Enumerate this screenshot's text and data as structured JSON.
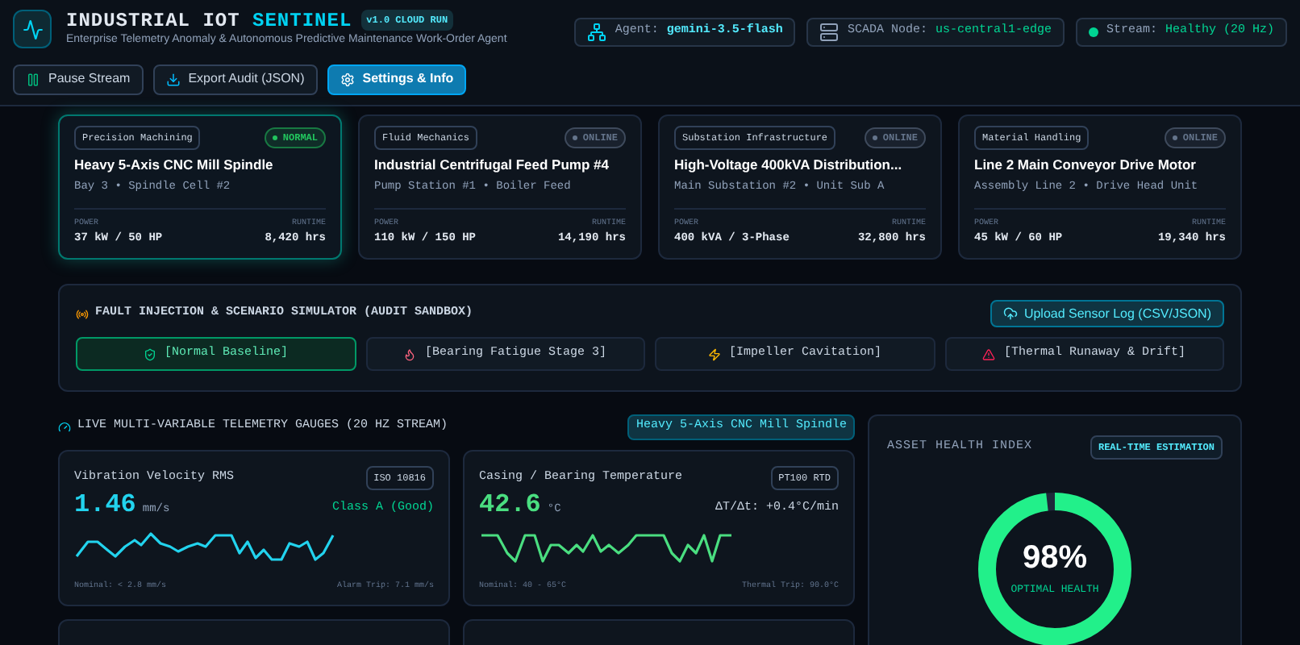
{
  "header": {
    "title_main": "INDUSTRIAL IOT",
    "title_accent": "SENTINEL",
    "version": "v1.0 CLOUD RUN",
    "subtitle": "Enterprise Telemetry Anomaly & Autonomous Predictive Maintenance Work-Order Agent",
    "buttons": [
      {
        "label": "Pause Stream",
        "kind": "pause",
        "primary": false
      },
      {
        "label": "Export Audit (JSON)",
        "kind": "export",
        "primary": false
      },
      {
        "label": "Settings & Info",
        "kind": "settings",
        "primary": true
      }
    ],
    "status_pills": [
      {
        "kind": "agent",
        "label": "Agent:",
        "value": "gemini-3.5-flash"
      },
      {
        "kind": "node",
        "label": "SCADA Node:",
        "value": "us-central1-edge"
      },
      {
        "kind": "stream",
        "label": "Stream:",
        "value": "Healthy (20 Hz)"
      }
    ]
  },
  "assets": [
    {
      "category": "Precision Machining",
      "status": "NORMAL",
      "color": "#22c55e",
      "selected": true,
      "name": "Heavy 5-Axis CNC Mill Spindle",
      "location": "Bay 3 • Spindle Cell #2",
      "power_label": "POWER",
      "power": "37 kW / 50 HP",
      "runtime_label": "RUNTIME",
      "runtime": "8,420 hrs"
    },
    {
      "category": "Fluid Mechanics",
      "status": "ONLINE",
      "color": "#64748b",
      "selected": false,
      "name": "Industrial Centrifugal Feed Pump #4",
      "location": "Pump Station #1 • Boiler Feed",
      "power_label": "POWER",
      "power": "110 kW / 150 HP",
      "runtime_label": "RUNTIME",
      "runtime": "14,190 hrs"
    },
    {
      "category": "Substation Infrastructure",
      "status": "ONLINE",
      "color": "#64748b",
      "selected": false,
      "name": "High-Voltage 400kVA Distribution...",
      "location": "Main Substation #2 • Unit Sub A",
      "power_label": "POWER",
      "power": "400 kVA / 3-Phase",
      "runtime_label": "RUNTIME",
      "runtime": "32,800 hrs"
    },
    {
      "category": "Material Handling",
      "status": "ONLINE",
      "color": "#64748b",
      "selected": false,
      "name": "Line 2 Main Conveyor Drive Motor",
      "location": "Assembly Line 2 • Drive Head Unit",
      "power_label": "POWER",
      "power": "45 kW / 60 HP",
      "runtime_label": "RUNTIME",
      "runtime": "19,340 hrs"
    }
  ],
  "simulator": {
    "title": "FAULT INJECTION & SCENARIO SIMULATOR (AUDIT SANDBOX)",
    "upload_button": "Upload Sensor Log (CSV/JSON)",
    "scenarios": [
      {
        "kind": "normal",
        "label": "[Normal Baseline]",
        "selected": true
      },
      {
        "kind": "bearing",
        "label": "[Bearing Fatigue Stage 3]",
        "selected": false
      },
      {
        "kind": "impeller",
        "label": "[Impeller Cavitation]",
        "selected": false
      },
      {
        "kind": "thermal",
        "label": "[Thermal Runaway & Drift]",
        "selected": false
      }
    ]
  },
  "telemetry": {
    "title": "LIVE MULTI-VARIABLE TELEMETRY GAUGES (20 HZ STREAM)",
    "asset_badge": "Heavy 5-Axis CNC Mill Spindle",
    "gauges": [
      {
        "title": "Vibration Velocity RMS",
        "standard": "ISO 10816",
        "value": "1.46",
        "unit": "mm/s",
        "color": "#22d3ee",
        "reading": "Class A (Good)",
        "kind": "good",
        "nominal": "Nominal: < 2.8 mm/s",
        "trip": "Alarm Trip: 7.1 mm/s"
      },
      {
        "title": "Casing / Bearing Temperature",
        "standard": "PT100 RTD",
        "value": "42.6",
        "unit": "°C",
        "color": "#4ade80",
        "reading": "ΔT/Δt: +0.4°C/min",
        "kind": "info",
        "nominal": "Nominal: 40 - 65°C",
        "trip": "Thermal Trip: 90.0°C"
      }
    ]
  },
  "health": {
    "title": "ASSET HEALTH INDEX",
    "badge": "REAL-TIME ESTIMATION",
    "value": "98%",
    "label": "OPTIMAL HEALTH",
    "level": 0.98
  }
}
